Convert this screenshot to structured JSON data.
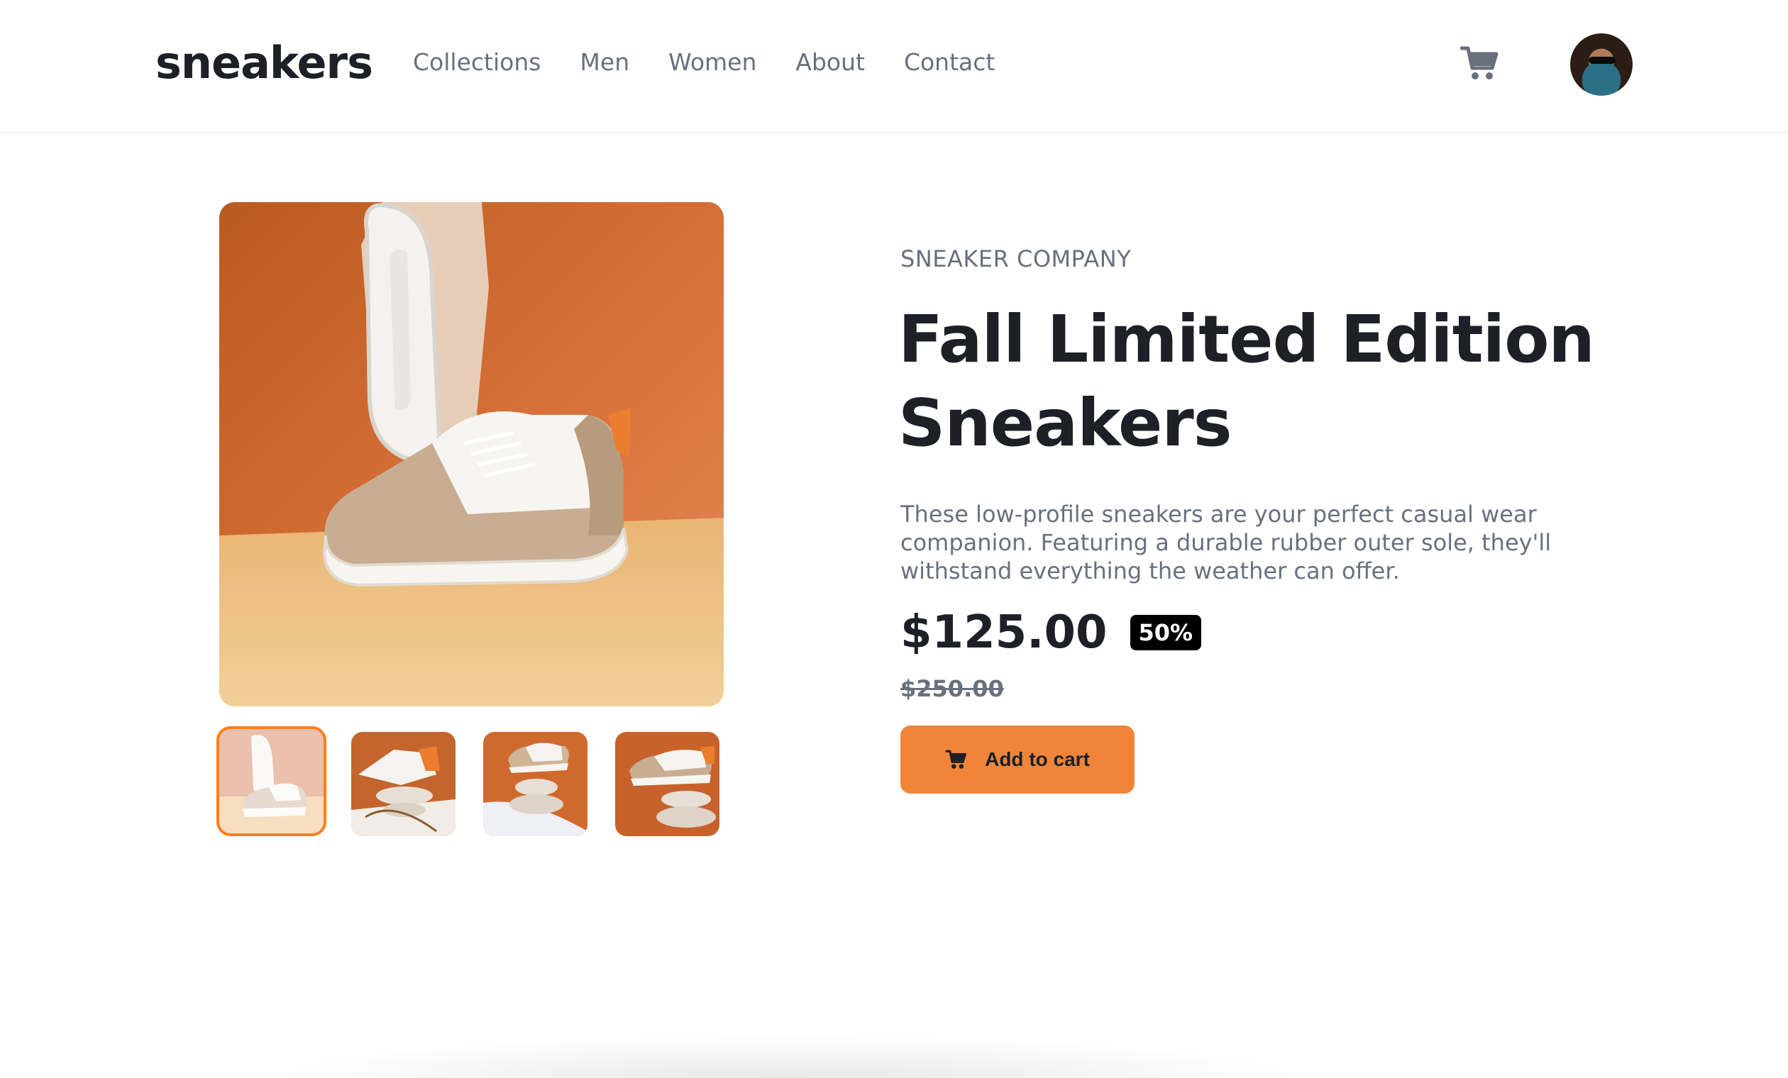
{
  "header": {
    "logo": "sneakers",
    "nav": [
      "Collections",
      "Men",
      "Women",
      "About",
      "Contact"
    ]
  },
  "gallery": {
    "thumbnail_count": 4,
    "selected_index": 0
  },
  "product": {
    "company": "SNEAKER COMPANY",
    "title_line1": "Fall Limited Edition",
    "title_line2": "Sneakers",
    "description": "These low-profile sneakers are your perfect casual wear companion. Featuring a durable rubber outer sole, they'll withstand everything the weather can offer.",
    "price": "$125.00",
    "discount": "50%",
    "original_price": "$250.00",
    "add_to_cart_label": "Add to cart"
  },
  "colors": {
    "accent": "#ff7d1a",
    "button": "#f0853a",
    "text_dark": "#1d2026",
    "text_muted": "#69707d"
  },
  "icons": {
    "cart": "cart-icon",
    "avatar": "avatar"
  }
}
